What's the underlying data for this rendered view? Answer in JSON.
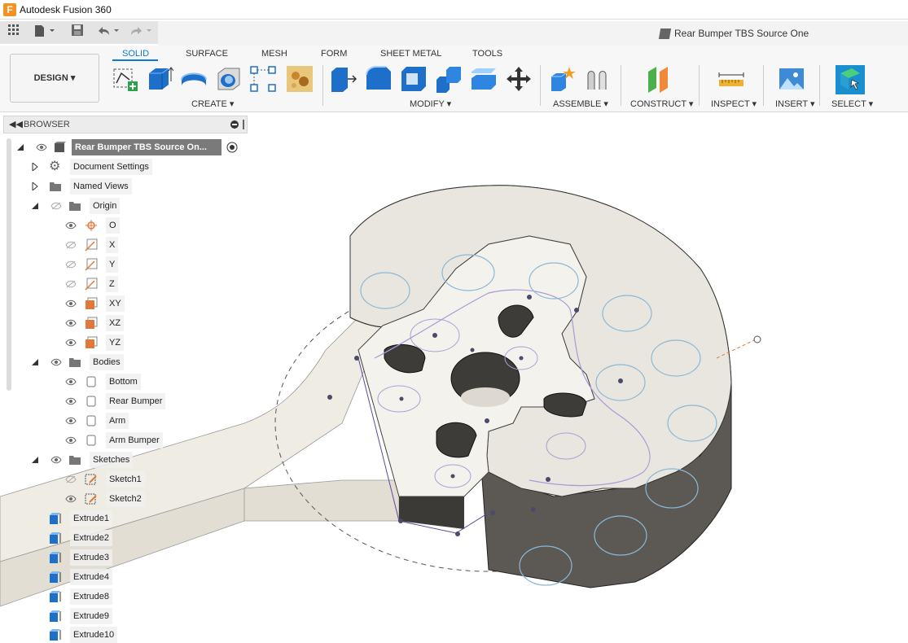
{
  "app": {
    "title": "Autodesk Fusion 360",
    "logo": "F"
  },
  "document": {
    "title": "Rear Bumper TBS Source One"
  },
  "ribbon": {
    "workspace": "DESIGN",
    "tabs": [
      "SOLID",
      "SURFACE",
      "MESH",
      "FORM",
      "SHEET METAL",
      "TOOLS"
    ],
    "active_tab": "SOLID",
    "groups": [
      "CREATE",
      "MODIFY",
      "ASSEMBLE",
      "CONSTRUCT",
      "INSPECT",
      "INSERT",
      "SELECT"
    ]
  },
  "browser": {
    "title": "BROWSER",
    "root": "Rear Bumper TBS Source On...",
    "items": [
      {
        "label": "Document Settings"
      },
      {
        "label": "Named Views"
      },
      {
        "label": "Origin"
      },
      {
        "label": "O"
      },
      {
        "label": "X"
      },
      {
        "label": "Y"
      },
      {
        "label": "Z"
      },
      {
        "label": "XY"
      },
      {
        "label": "XZ"
      },
      {
        "label": "YZ"
      },
      {
        "label": "Bodies"
      },
      {
        "label": "Bottom"
      },
      {
        "label": "Rear Bumper"
      },
      {
        "label": "Arm"
      },
      {
        "label": "Arm Bumper"
      },
      {
        "label": "Sketches"
      },
      {
        "label": "Sketch1"
      },
      {
        "label": "Sketch2"
      }
    ],
    "features": [
      "Extrude1",
      "Extrude2",
      "Extrude3",
      "Extrude4",
      "Extrude8",
      "Extrude9",
      "Extrude10"
    ]
  },
  "colors": {
    "accent": "#0a7ad6",
    "origin_plane": "#e07a3a",
    "solid_face": "#eeebe4",
    "solid_side": "#5a5752"
  }
}
